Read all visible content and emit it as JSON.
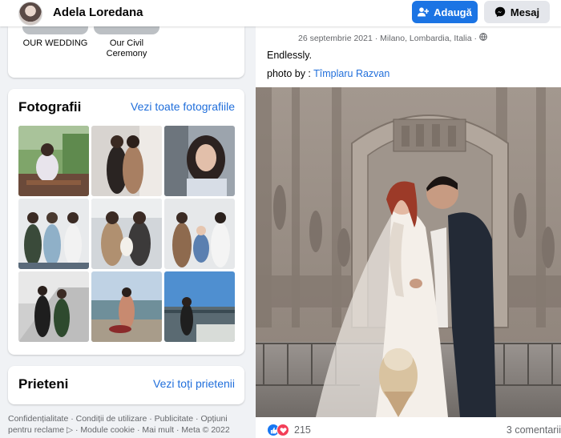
{
  "header": {
    "profile_name": "Adela Loredana",
    "add_button_label": "Adaugă",
    "message_button_label": "Mesaj"
  },
  "highlights": [
    {
      "label": "OUR WEDDING"
    },
    {
      "label": "Our Civil\nCeremony"
    }
  ],
  "photos": {
    "title": "Fotografii",
    "see_all_label": "Vezi toate fotografiile"
  },
  "friends": {
    "title": "Prieteni",
    "see_all_label": "Vezi toți prietenii"
  },
  "footer": {
    "text": "Confidențialitate · Condiții de utilizare · Publicitate · Opțiuni pentru reclame ▷ · Module cookie · Mai mult · Meta © 2022"
  },
  "post": {
    "date": "26 septembrie 2021",
    "location": "Milano, Lombardia, Italia",
    "text": "Endlessly.",
    "credit_prefix": "photo by : ",
    "credit_name": "Tîmplaru Razvan",
    "reaction_count": "215",
    "comments_label": "3 comentarii"
  },
  "colors": {
    "accent": "#1b74e4",
    "link": "#216fdb",
    "background": "#f0f2f5"
  },
  "icons": {
    "add": "person-plus-icon",
    "message": "messenger-icon",
    "privacy": "globe-icon",
    "like": "like-icon",
    "love": "love-icon"
  }
}
